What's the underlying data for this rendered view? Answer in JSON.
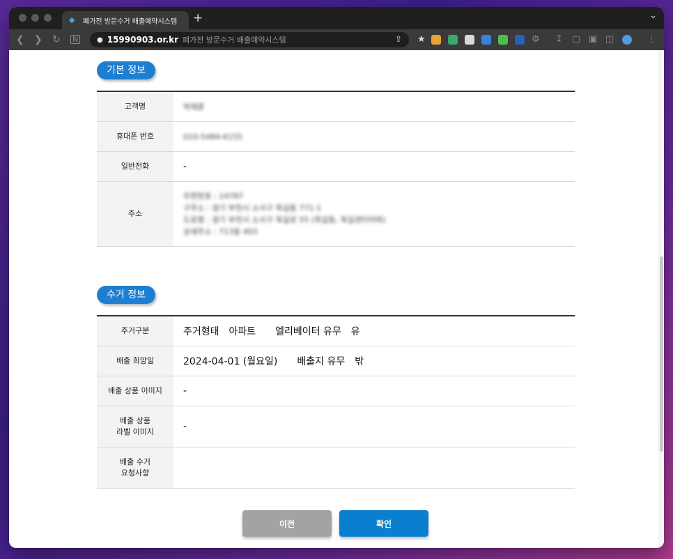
{
  "browser": {
    "tab_title": "폐가전 방문수거 배출예약시스템",
    "new_tab_symbol": "+",
    "address_host": "15990903.or.kr",
    "address_title": "폐가전 방문수거 배출예약시스템"
  },
  "basic_info": {
    "section_label": "기본 정보",
    "rows": [
      {
        "label": "고객명",
        "value": "박재훈"
      },
      {
        "label": "휴대폰 번호",
        "value": "010-5484-6155"
      },
      {
        "label": "일반전화",
        "value": "-"
      },
      {
        "label": "주소",
        "lines": [
          "우편번호 : 14787",
          "구주소 : 경기 부천시 소사구 옥길동 771-1",
          "도로명 : 경기 부천시 소사구 옥길로 55 (옥길동, 옥길센터아파)",
          "상세주소 : 713동 403"
        ]
      }
    ]
  },
  "pickup_info": {
    "section_label": "수거 정보",
    "residence": {
      "label": "주거구분",
      "type_key": "주거형태",
      "type_value": "아파트",
      "elevator_key": "엘리베이터 유무",
      "elevator_value": "유"
    },
    "date": {
      "label": "배출 희망일",
      "value": "2024-04-01 (월요일)",
      "place_key": "배출지 유무",
      "place_value": "밖"
    },
    "product_image": {
      "label": "배출 상품 이미지",
      "value": "-"
    },
    "label_image": {
      "label_line1": "배출 상품",
      "label_line2": "라벨 이미지",
      "value": "-"
    },
    "request": {
      "label_line1": "배출 수거",
      "label_line2": "요청사항",
      "value": ""
    }
  },
  "buttons": {
    "prev": "이전",
    "confirm": "확인"
  },
  "colors": {
    "accent": "#1d7fd0",
    "prev_button": "#a3a3a3",
    "confirm_button": "#0a7fcf"
  }
}
